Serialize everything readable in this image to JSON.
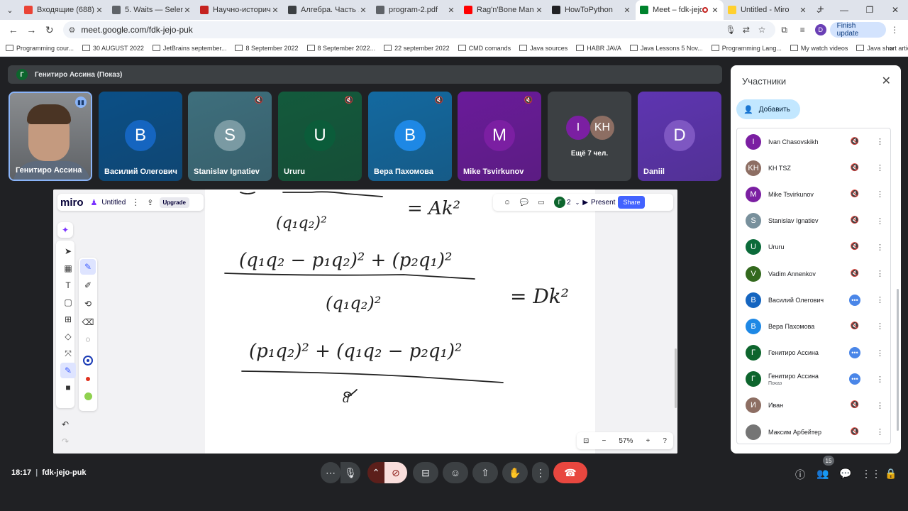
{
  "browser": {
    "tabs": [
      {
        "title": "Входящие (688) - da",
        "color": "#ea4335",
        "active": false
      },
      {
        "title": "5. Waits — Selenium",
        "color": "#5f6368",
        "active": false
      },
      {
        "title": "Научно-историческ",
        "color": "#c5221f",
        "active": false
      },
      {
        "title": "Алгебра. Часть 1 | С",
        "color": "#3c4043",
        "active": false
      },
      {
        "title": "program-2.pdf",
        "color": "#5f6368",
        "active": false
      },
      {
        "title": "Rag'n'Bone Man - Li",
        "color": "#ff0000",
        "active": false
      },
      {
        "title": "HowToPython",
        "color": "#202124",
        "active": false
      },
      {
        "title": "Meet – fdk-jejo-p",
        "color": "#00832d",
        "active": true
      },
      {
        "title": "Untitled - Miro",
        "color": "#ffd02f",
        "active": false
      }
    ],
    "url": "meet.google.com/fdk-jejo-puk",
    "profile_initial": "D",
    "finish_update": "Finish update",
    "bookmarks": [
      "Programming cour...",
      "30 AUGUST 2022",
      "JetBrains september...",
      "8 September 2022",
      "8 September 2022...",
      "22 september 2022",
      "CMD comands",
      "Java sources",
      "HABR JAVA",
      "Java Lessons 5 Nov...",
      "Programming Lang...",
      "My watch videos",
      "Java short articles"
    ]
  },
  "meet": {
    "presenting_label": "Генитиро Ассина (Показ)",
    "presenting_initial": "Г",
    "tiles": [
      {
        "name": "Генитиро Ассина",
        "initial": "",
        "bg": "#6b6f75",
        "avatar": "",
        "camera": true,
        "speaking": true
      },
      {
        "name": "Василий Олегович",
        "initial": "В",
        "bg": "#0b4f86",
        "avatar": "#1565c0",
        "muted": false
      },
      {
        "name": "Stanislav Ignatiev",
        "initial": "S",
        "bg": "#3e6f7d",
        "avatar": "#7a9aa3",
        "muted": true
      },
      {
        "name": "Ururu",
        "initial": "U",
        "bg": "#135a3c",
        "avatar": "#0b5c3a",
        "muted": true
      },
      {
        "name": "Вера Пахомова",
        "initial": "В",
        "bg": "#1369a0",
        "avatar": "#1e88e5",
        "muted": true
      },
      {
        "name": "Mike Tsvirkunov",
        "initial": "M",
        "bg": "#6a1b9a",
        "avatar": "#7b1fa2",
        "muted": true
      },
      {
        "name": "Daniil",
        "initial": "D",
        "bg": "#5e35b1",
        "avatar": "#7e57c2",
        "muted": false
      }
    ],
    "more_tile": {
      "label": "Ещё 7 чел.",
      "initial_1": "I",
      "initial_2": "KH"
    },
    "panel": {
      "title": "Участники",
      "add_label": "Добавить",
      "participants": [
        {
          "initial": "I",
          "name": "Ivan Chasovskikh",
          "color": "#7b1fa2",
          "status": "muted"
        },
        {
          "initial": "KH",
          "name": "KH TSZ",
          "color": "#8d6e63",
          "status": "muted"
        },
        {
          "initial": "M",
          "name": "Mike Tsvirkunov",
          "color": "#7b1fa2",
          "status": "muted"
        },
        {
          "initial": "S",
          "name": "Stanislav Ignatiev",
          "color": "#78909c",
          "status": "muted"
        },
        {
          "initial": "U",
          "name": "Ururu",
          "color": "#0b6b3a",
          "status": "muted"
        },
        {
          "initial": "V",
          "name": "Vadim Annenkov",
          "color": "#33691e",
          "status": "muted"
        },
        {
          "initial": "В",
          "name": "Василий Олегович",
          "color": "#1565c0",
          "status": "active"
        },
        {
          "initial": "В",
          "name": "Вера Пахомова",
          "color": "#1e88e5",
          "status": "muted"
        },
        {
          "initial": "Г",
          "name": "Генитиро Ассина",
          "color": "#0d652d",
          "status": "active"
        },
        {
          "initial": "Г",
          "name": "Генитиро Ассина",
          "sub": "Показ",
          "color": "#0d652d",
          "status": "active"
        },
        {
          "initial": "И",
          "name": "Иван",
          "color": "#8d6e63",
          "status": "muted"
        },
        {
          "initial": "",
          "name": "Максим Арбейтер",
          "color": "#757575",
          "status": "muted"
        }
      ]
    },
    "bottom": {
      "time": "18:17",
      "meeting_code": "fdk-jejo-puk",
      "participants_badge": "15"
    }
  },
  "miro": {
    "logo": "miro",
    "board_name": "Untitled",
    "upgrade_label": "Upgrade",
    "collaborators_count": "2",
    "collab_initial": "Г",
    "present_label": "Present",
    "share_label": "Share",
    "zoom": "57%",
    "handwriting": {
      "line1_den": "(q₁q₂)²",
      "line1_rhs": "= Ak²",
      "line2_num": "(q₁q₂ − p₁q₂)² + (p₂q₁)²",
      "line2_den": "(q₁q₂)²",
      "line2_rhs": "= Dk²",
      "line3_num": "(p₁q₂)² + (q₁q₂ − p₂q₁)²",
      "line3_den": "d"
    }
  },
  "colors": {
    "meet_bg": "#202124",
    "end_call": "#e8473f",
    "miro_accent": "#4262ff"
  }
}
